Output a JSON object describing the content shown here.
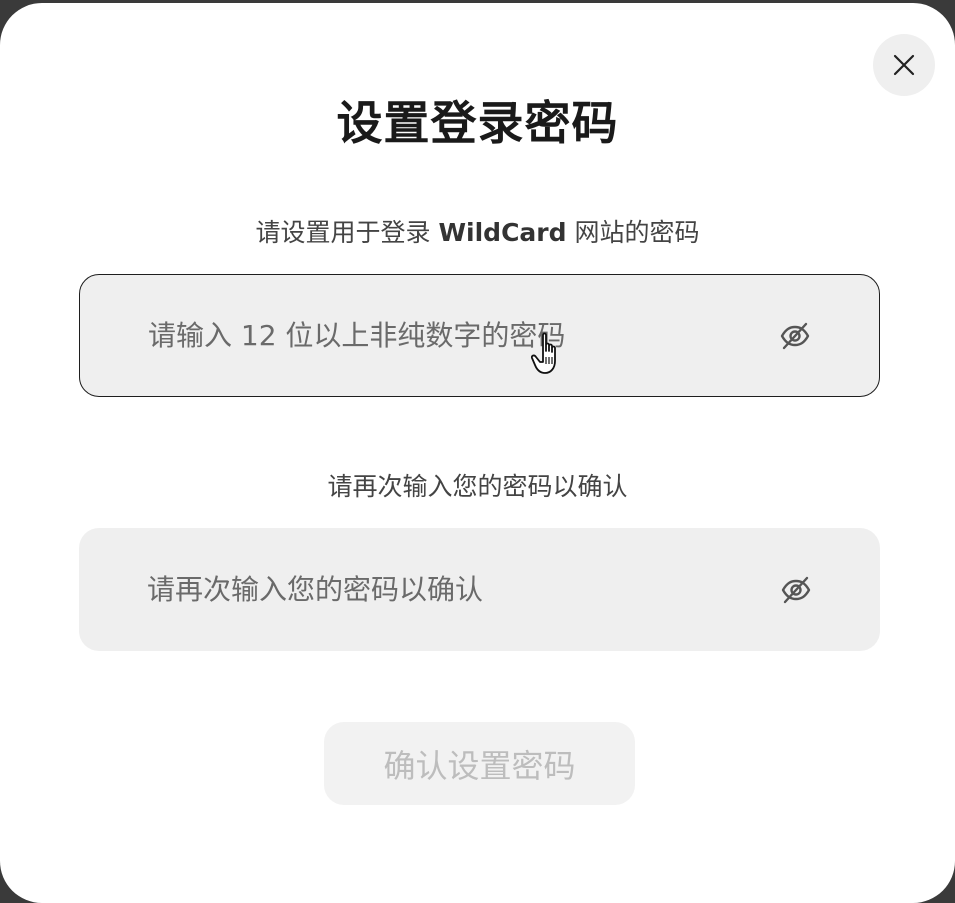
{
  "dialog": {
    "title": "设置登录密码",
    "close_icon": "close-icon"
  },
  "password": {
    "label_prefix": "请设置用于登录",
    "label_brand": "WildCard",
    "label_suffix": "网站的密码",
    "placeholder": "请输入 12 位以上非纯数字的密码",
    "value": "",
    "toggle_icon": "eye-off-icon"
  },
  "confirm": {
    "label": "请再次输入您的密码以确认",
    "placeholder": "请再次输入您的密码以确认",
    "value": "",
    "toggle_icon": "eye-off-icon"
  },
  "submit": {
    "label": "确认设置密码",
    "enabled": false
  },
  "colors": {
    "backdrop": "#3a3a3a",
    "dialog_bg": "#ffffff",
    "field_bg": "#efefef",
    "focus_border": "#1e1e1e",
    "button_disabled_bg": "#f2f2f2",
    "button_disabled_text": "#bdbdbd"
  }
}
